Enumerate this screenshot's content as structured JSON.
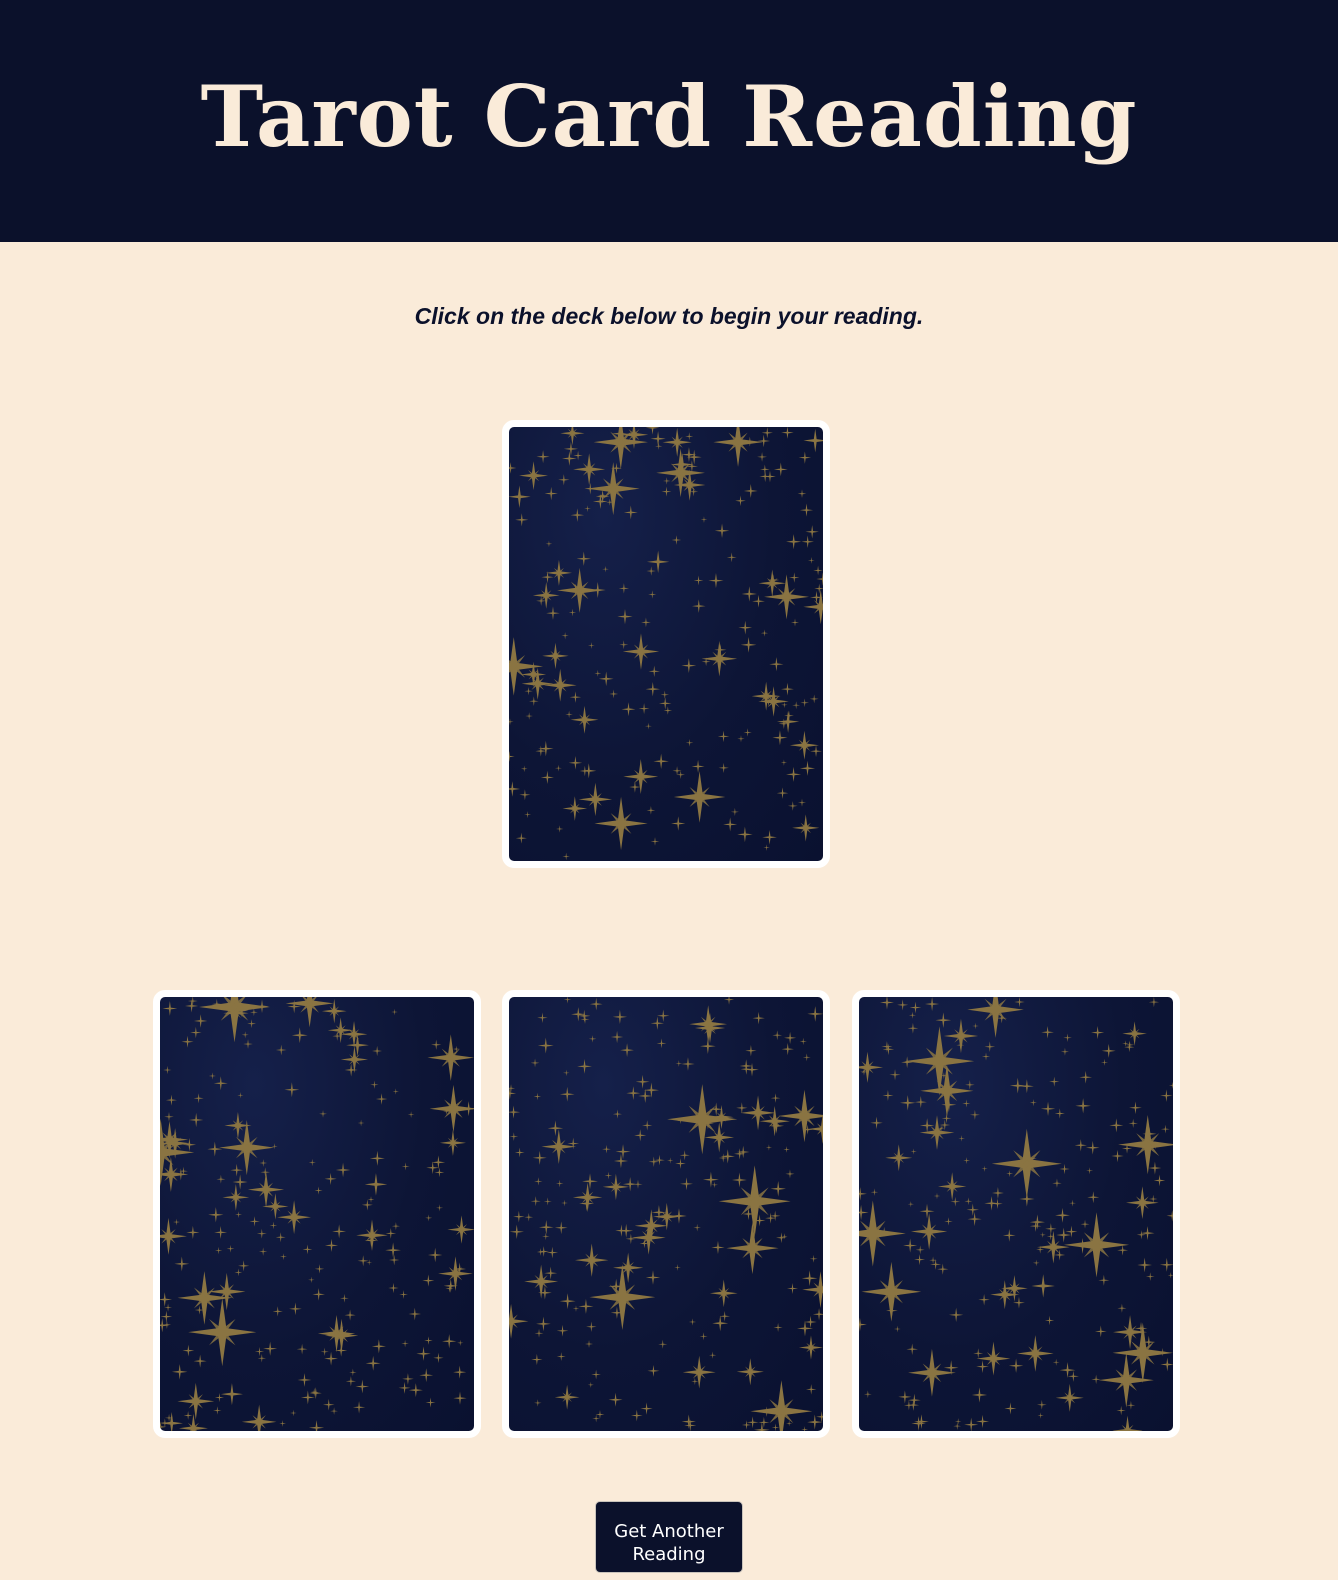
{
  "header": {
    "title": "Tarot Card Reading"
  },
  "main": {
    "instruction": "Click on the deck below to begin your reading."
  },
  "cards": {
    "deck": {
      "name": "tarot-deck",
      "face": "back"
    },
    "spread": [
      {
        "name": "card-slot-1",
        "face": "back"
      },
      {
        "name": "card-slot-2",
        "face": "back"
      },
      {
        "name": "card-slot-3",
        "face": "back"
      }
    ],
    "back_icon": "star-pattern-icon"
  },
  "actions": {
    "another_reading_label": "Get Another Reading"
  },
  "colors": {
    "header_bg": "#0b112b",
    "page_bg": "#faebd9",
    "title_color": "#faebd9",
    "card_back": "#0d1536",
    "star_color": "#8a7442",
    "button_bg": "#0b112b"
  }
}
